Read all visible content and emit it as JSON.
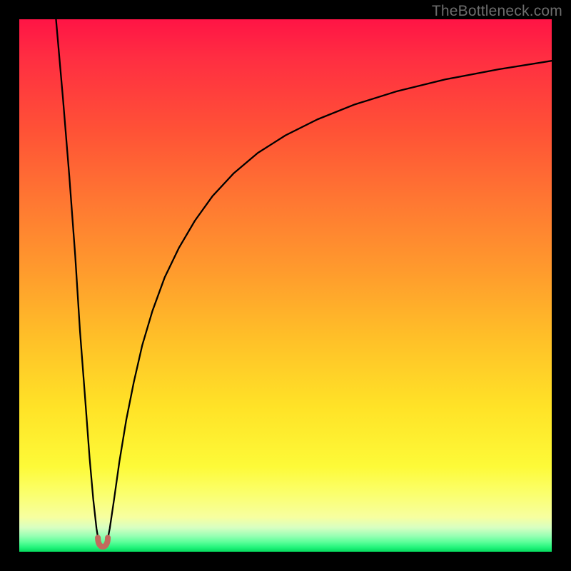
{
  "watermark": "TheBottleneck.com",
  "chart_data": {
    "type": "line",
    "title": "",
    "xlabel": "",
    "ylabel": "",
    "xrange": [
      0,
      100
    ],
    "yrange": [
      0,
      100
    ],
    "note": "No axis tick labels are rendered; values are normalized percentages of the plot area (0=left/bottom, 100=right/top). Curves trace a sharp V-minimum near x≈15 then asymptotically rise to the right.",
    "series": [
      {
        "name": "left-branch",
        "x": [
          6.9,
          8.2,
          9.4,
          10.5,
          11.4,
          12.4,
          13.2,
          13.9,
          14.5,
          15.0
        ],
        "y": [
          100,
          85.2,
          70.5,
          55.7,
          41.5,
          28.4,
          17.7,
          9.8,
          4.4,
          1.3
        ]
      },
      {
        "name": "right-branch",
        "x": [
          16.4,
          17.0,
          17.8,
          18.8,
          20.1,
          21.5,
          23.1,
          25.0,
          27.3,
          30.0,
          33.0,
          36.3,
          40.3,
          44.8,
          50.0,
          56.0,
          63.0,
          71.0,
          80.0,
          90.0,
          100.0
        ],
        "y": [
          1.3,
          4.4,
          9.8,
          16.9,
          24.8,
          31.8,
          38.8,
          45.2,
          51.5,
          57.1,
          62.2,
          66.8,
          71.1,
          74.9,
          78.2,
          81.2,
          84.0,
          86.5,
          88.7,
          90.6,
          92.2
        ]
      },
      {
        "name": "minimum-marker",
        "marker": "u-shape",
        "color": "#c36a5d",
        "x": [
          15.7
        ],
        "y": [
          0.9
        ]
      }
    ]
  }
}
